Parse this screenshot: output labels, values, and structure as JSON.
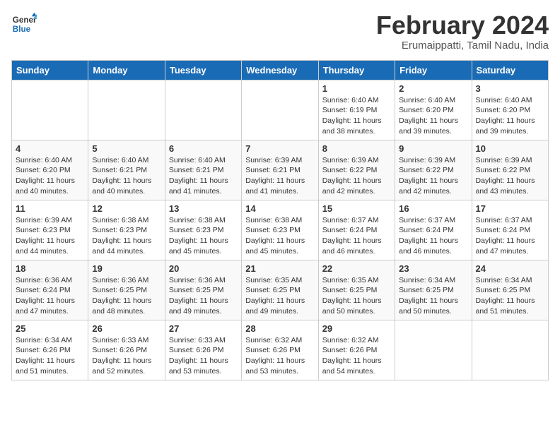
{
  "logo": {
    "line1": "General",
    "line2": "Blue"
  },
  "calendar": {
    "title": "February 2024",
    "subtitle": "Erumaippatti, Tamil Nadu, India",
    "days_of_week": [
      "Sunday",
      "Monday",
      "Tuesday",
      "Wednesday",
      "Thursday",
      "Friday",
      "Saturday"
    ],
    "weeks": [
      [
        {
          "day": "",
          "info": ""
        },
        {
          "day": "",
          "info": ""
        },
        {
          "day": "",
          "info": ""
        },
        {
          "day": "",
          "info": ""
        },
        {
          "day": "1",
          "info": "Sunrise: 6:40 AM\nSunset: 6:19 PM\nDaylight: 11 hours\nand 38 minutes."
        },
        {
          "day": "2",
          "info": "Sunrise: 6:40 AM\nSunset: 6:20 PM\nDaylight: 11 hours\nand 39 minutes."
        },
        {
          "day": "3",
          "info": "Sunrise: 6:40 AM\nSunset: 6:20 PM\nDaylight: 11 hours\nand 39 minutes."
        }
      ],
      [
        {
          "day": "4",
          "info": "Sunrise: 6:40 AM\nSunset: 6:20 PM\nDaylight: 11 hours\nand 40 minutes."
        },
        {
          "day": "5",
          "info": "Sunrise: 6:40 AM\nSunset: 6:21 PM\nDaylight: 11 hours\nand 40 minutes."
        },
        {
          "day": "6",
          "info": "Sunrise: 6:40 AM\nSunset: 6:21 PM\nDaylight: 11 hours\nand 41 minutes."
        },
        {
          "day": "7",
          "info": "Sunrise: 6:39 AM\nSunset: 6:21 PM\nDaylight: 11 hours\nand 41 minutes."
        },
        {
          "day": "8",
          "info": "Sunrise: 6:39 AM\nSunset: 6:22 PM\nDaylight: 11 hours\nand 42 minutes."
        },
        {
          "day": "9",
          "info": "Sunrise: 6:39 AM\nSunset: 6:22 PM\nDaylight: 11 hours\nand 42 minutes."
        },
        {
          "day": "10",
          "info": "Sunrise: 6:39 AM\nSunset: 6:22 PM\nDaylight: 11 hours\nand 43 minutes."
        }
      ],
      [
        {
          "day": "11",
          "info": "Sunrise: 6:39 AM\nSunset: 6:23 PM\nDaylight: 11 hours\nand 44 minutes."
        },
        {
          "day": "12",
          "info": "Sunrise: 6:38 AM\nSunset: 6:23 PM\nDaylight: 11 hours\nand 44 minutes."
        },
        {
          "day": "13",
          "info": "Sunrise: 6:38 AM\nSunset: 6:23 PM\nDaylight: 11 hours\nand 45 minutes."
        },
        {
          "day": "14",
          "info": "Sunrise: 6:38 AM\nSunset: 6:23 PM\nDaylight: 11 hours\nand 45 minutes."
        },
        {
          "day": "15",
          "info": "Sunrise: 6:37 AM\nSunset: 6:24 PM\nDaylight: 11 hours\nand 46 minutes."
        },
        {
          "day": "16",
          "info": "Sunrise: 6:37 AM\nSunset: 6:24 PM\nDaylight: 11 hours\nand 46 minutes."
        },
        {
          "day": "17",
          "info": "Sunrise: 6:37 AM\nSunset: 6:24 PM\nDaylight: 11 hours\nand 47 minutes."
        }
      ],
      [
        {
          "day": "18",
          "info": "Sunrise: 6:36 AM\nSunset: 6:24 PM\nDaylight: 11 hours\nand 47 minutes."
        },
        {
          "day": "19",
          "info": "Sunrise: 6:36 AM\nSunset: 6:25 PM\nDaylight: 11 hours\nand 48 minutes."
        },
        {
          "day": "20",
          "info": "Sunrise: 6:36 AM\nSunset: 6:25 PM\nDaylight: 11 hours\nand 49 minutes."
        },
        {
          "day": "21",
          "info": "Sunrise: 6:35 AM\nSunset: 6:25 PM\nDaylight: 11 hours\nand 49 minutes."
        },
        {
          "day": "22",
          "info": "Sunrise: 6:35 AM\nSunset: 6:25 PM\nDaylight: 11 hours\nand 50 minutes."
        },
        {
          "day": "23",
          "info": "Sunrise: 6:34 AM\nSunset: 6:25 PM\nDaylight: 11 hours\nand 50 minutes."
        },
        {
          "day": "24",
          "info": "Sunrise: 6:34 AM\nSunset: 6:25 PM\nDaylight: 11 hours\nand 51 minutes."
        }
      ],
      [
        {
          "day": "25",
          "info": "Sunrise: 6:34 AM\nSunset: 6:26 PM\nDaylight: 11 hours\nand 51 minutes."
        },
        {
          "day": "26",
          "info": "Sunrise: 6:33 AM\nSunset: 6:26 PM\nDaylight: 11 hours\nand 52 minutes."
        },
        {
          "day": "27",
          "info": "Sunrise: 6:33 AM\nSunset: 6:26 PM\nDaylight: 11 hours\nand 53 minutes."
        },
        {
          "day": "28",
          "info": "Sunrise: 6:32 AM\nSunset: 6:26 PM\nDaylight: 11 hours\nand 53 minutes."
        },
        {
          "day": "29",
          "info": "Sunrise: 6:32 AM\nSunset: 6:26 PM\nDaylight: 11 hours\nand 54 minutes."
        },
        {
          "day": "",
          "info": ""
        },
        {
          "day": "",
          "info": ""
        }
      ]
    ]
  }
}
